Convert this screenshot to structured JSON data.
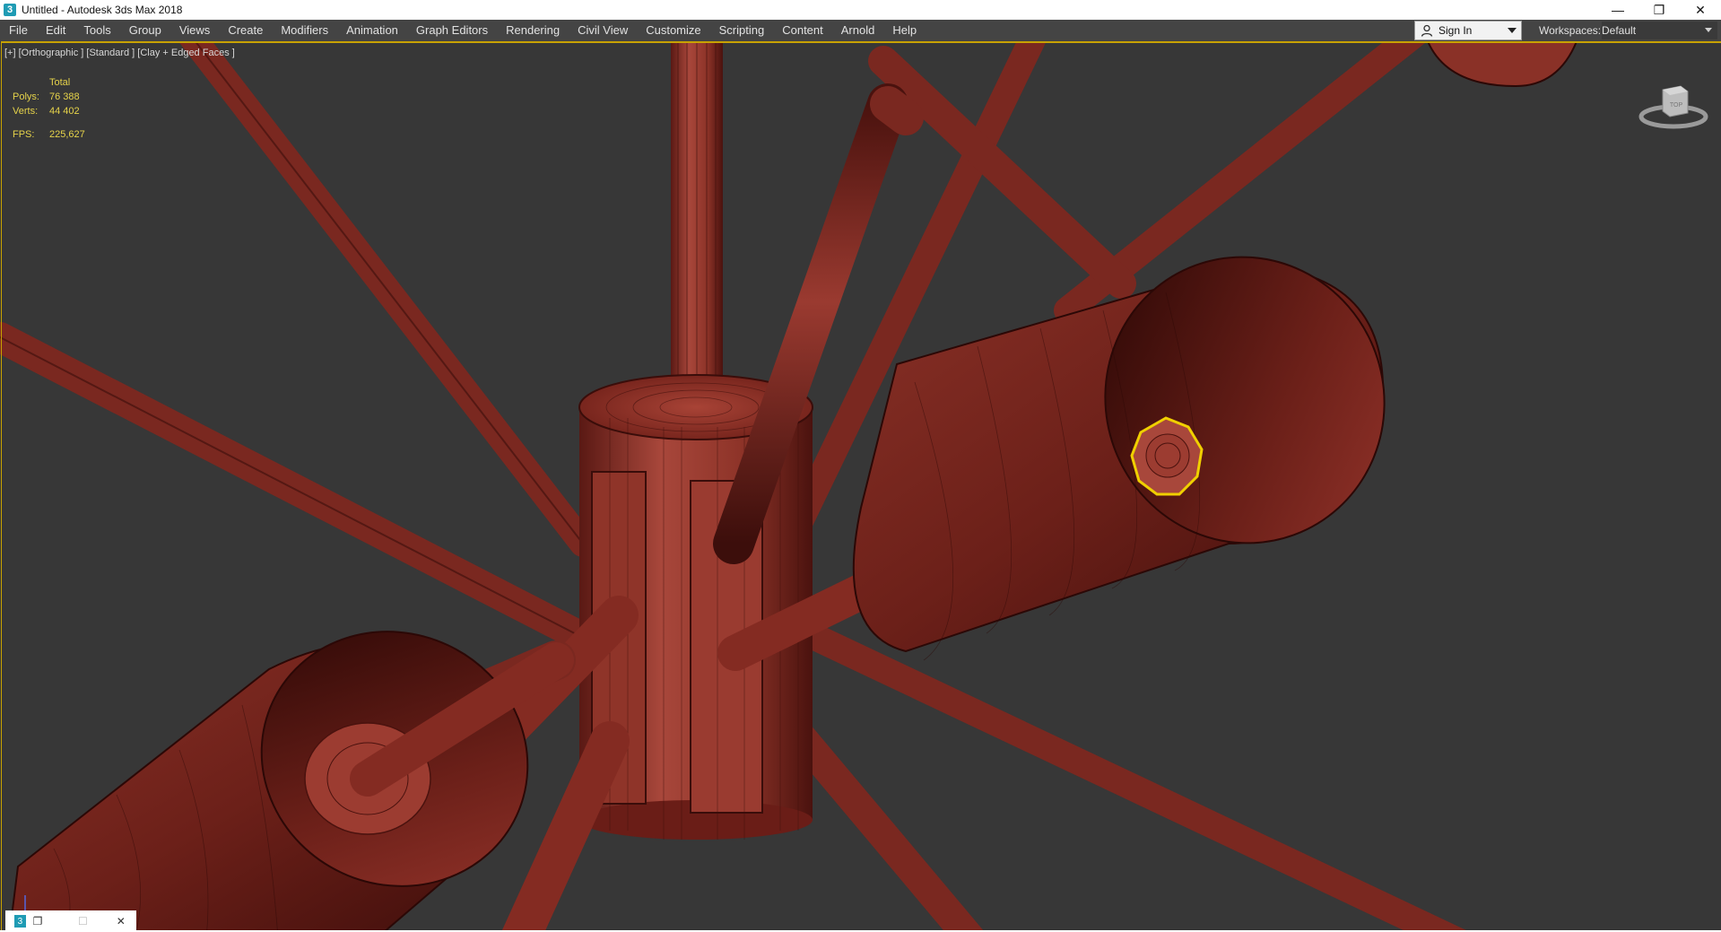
{
  "window": {
    "title": "Untitled - Autodesk 3ds Max 2018",
    "app_icon_glyph": "3",
    "minimize_glyph": "—",
    "restore_glyph": "❐",
    "close_glyph": "✕"
  },
  "menu": {
    "items": [
      "File",
      "Edit",
      "Tools",
      "Group",
      "Views",
      "Create",
      "Modifiers",
      "Animation",
      "Graph Editors",
      "Rendering",
      "Civil View",
      "Customize",
      "Scripting",
      "Content",
      "Arnold",
      "Help"
    ],
    "sign_in_label": "Sign In",
    "workspaces_label": "Workspaces:",
    "workspace_value": "Default"
  },
  "viewport": {
    "label": "[+] [Orthographic ] [Standard ] [Clay + Edged Faces ]",
    "stats": {
      "header": "Total",
      "polys_label": "Polys:",
      "polys_value": "76 388",
      "verts_label": "Verts:",
      "verts_value": "44 402",
      "fps_label": "FPS:",
      "fps_value": "225,627"
    },
    "viewcube_label": "TOP"
  },
  "taskbar": {
    "icon_glyph": "3",
    "restore_glyph": "❐",
    "maximize_glyph": "☐",
    "close_glyph": "✕"
  },
  "colors": {
    "viewport_bg": "#373737",
    "mesh_dark": "#5a1612",
    "mesh_mid": "#93332a",
    "mesh_light": "#b8473a",
    "selection": "#f0d000",
    "stats_text": "#e6d34a",
    "menubar_bg": "#444444"
  }
}
